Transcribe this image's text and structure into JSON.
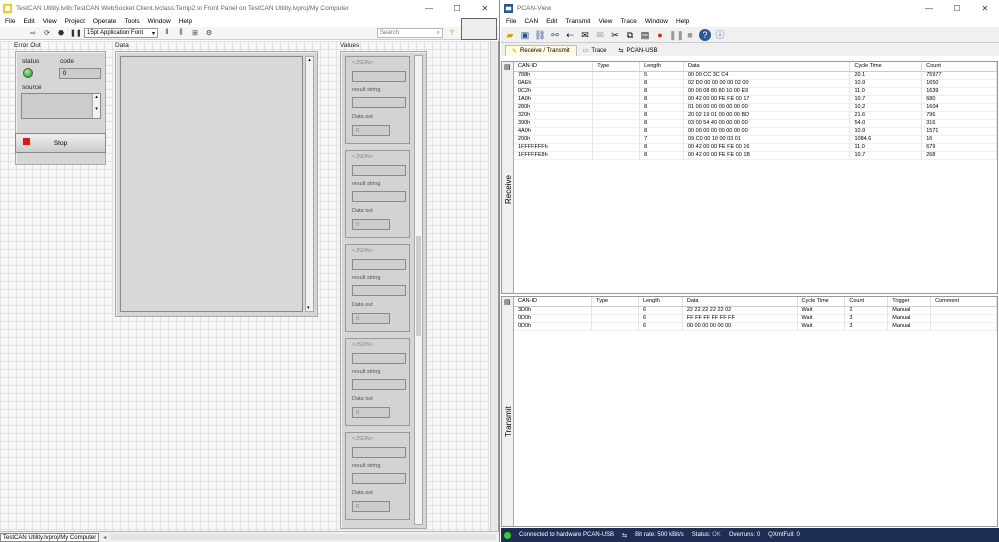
{
  "labview": {
    "title": "TestCAN Utility.lvlib:TestCAN WebSocket Client.lvclass:Temp2.vi Front Panel on TestCAN Utility.lvproj/My Computer",
    "menu": [
      "File",
      "Edit",
      "View",
      "Project",
      "Operate",
      "Tools",
      "Window",
      "Help"
    ],
    "font": "15pt Application Font",
    "search_placeholder": "Search",
    "error_out": {
      "label": "Error Out",
      "status": "status",
      "code": "code",
      "code_value": "0",
      "source": "source"
    },
    "data_label": "Data",
    "values_label": "Values",
    "stop_label": "Stop",
    "json_items": [
      {
        "json": "<JSON>",
        "result": "result string",
        "data_out": "Data out",
        "value": "0"
      },
      {
        "json": "<JSON>",
        "result": "result string",
        "data_out": "Data out",
        "value": "0"
      },
      {
        "json": "<JSON>",
        "result": "result string",
        "data_out": "Data out",
        "value": "0"
      },
      {
        "json": "<JSON>",
        "result": "result string",
        "data_out": "Data out",
        "value": "0"
      },
      {
        "json": "<JSON>",
        "result": "result string",
        "data_out": "Data out",
        "value": "0"
      }
    ],
    "status_path": "TestCAN Utility.lvproj/My Computer"
  },
  "pcan": {
    "title": "PCAN-View",
    "menu": [
      "File",
      "CAN",
      "Edit",
      "Transmit",
      "View",
      "Trace",
      "Window",
      "Help"
    ],
    "tabs": [
      "Receive / Transmit",
      "Trace",
      "PCAN-USB"
    ],
    "receive_label": "Receive",
    "transmit_label": "Transmit",
    "rx_headers": [
      "CAN-ID",
      "Type",
      "Length",
      "Data",
      "Cycle Time",
      "Count"
    ],
    "rx_rows": [
      [
        "788h",
        "",
        "5",
        "00 00 CC 3C C4",
        "20.1",
        "75977"
      ],
      [
        "0AEh",
        "",
        "8",
        "02 D0 00 00 00 00 02 00",
        "10.9",
        "1650"
      ],
      [
        "0C2h",
        "",
        "8",
        "00 00 08 80 80 10 00 E9",
        "11.0",
        "1639"
      ],
      [
        "1A0h",
        "",
        "8",
        "00 42 00 00 FE FE 00 17",
        "10.7",
        "680"
      ],
      [
        "280h",
        "",
        "8",
        "01 00 00 00 00 00 00 00",
        "10.2",
        "1604"
      ],
      [
        "320h",
        "",
        "8",
        "20 02 19 01 00 00 00 BD",
        "21.6",
        "796"
      ],
      [
        "390h",
        "",
        "8",
        "03 00 54 40 00 00 00 00",
        "54.0",
        "316"
      ],
      [
        "4A0h",
        "",
        "8",
        "00 00 00 00 00 00 00 00",
        "10.9",
        "1571"
      ],
      [
        "200h",
        "",
        "7",
        "09 C0 00 10 00 03 01",
        "1084.6",
        "16"
      ],
      [
        "1FFFFFFFh",
        "",
        "8",
        "00 42 00 00 FE FE 00 16",
        "11.0",
        "679"
      ],
      [
        "1FFFFFE8h",
        "",
        "8",
        "00 42 00 00 FE FE 00 1B",
        "10.7",
        "268"
      ]
    ],
    "tx_headers": [
      "CAN-ID",
      "Type",
      "Length",
      "Data",
      "Cycle Time",
      "Count",
      "Trigger",
      "Comment"
    ],
    "tx_rows": [
      [
        "3D0h",
        "",
        "6",
        "22 22 22 22 22 02",
        "Wait",
        "2",
        "Manual",
        ""
      ],
      [
        "0D0h",
        "",
        "6",
        "FF FF FF FF FF FF",
        "Wait",
        "3",
        "Manual",
        ""
      ],
      [
        "0D0h",
        "",
        "6",
        "00 00 00 00 00 00",
        "Wait",
        "3",
        "Manual",
        ""
      ]
    ],
    "status": {
      "connected": "Connected to hardware PCAN-USB",
      "bitrate": "Bit rate: 500 kBit/s",
      "status_label": "Status:",
      "status_value": "OK",
      "overruns": "Overruns: 0",
      "qxmt": "QXmtFull: 0"
    }
  }
}
